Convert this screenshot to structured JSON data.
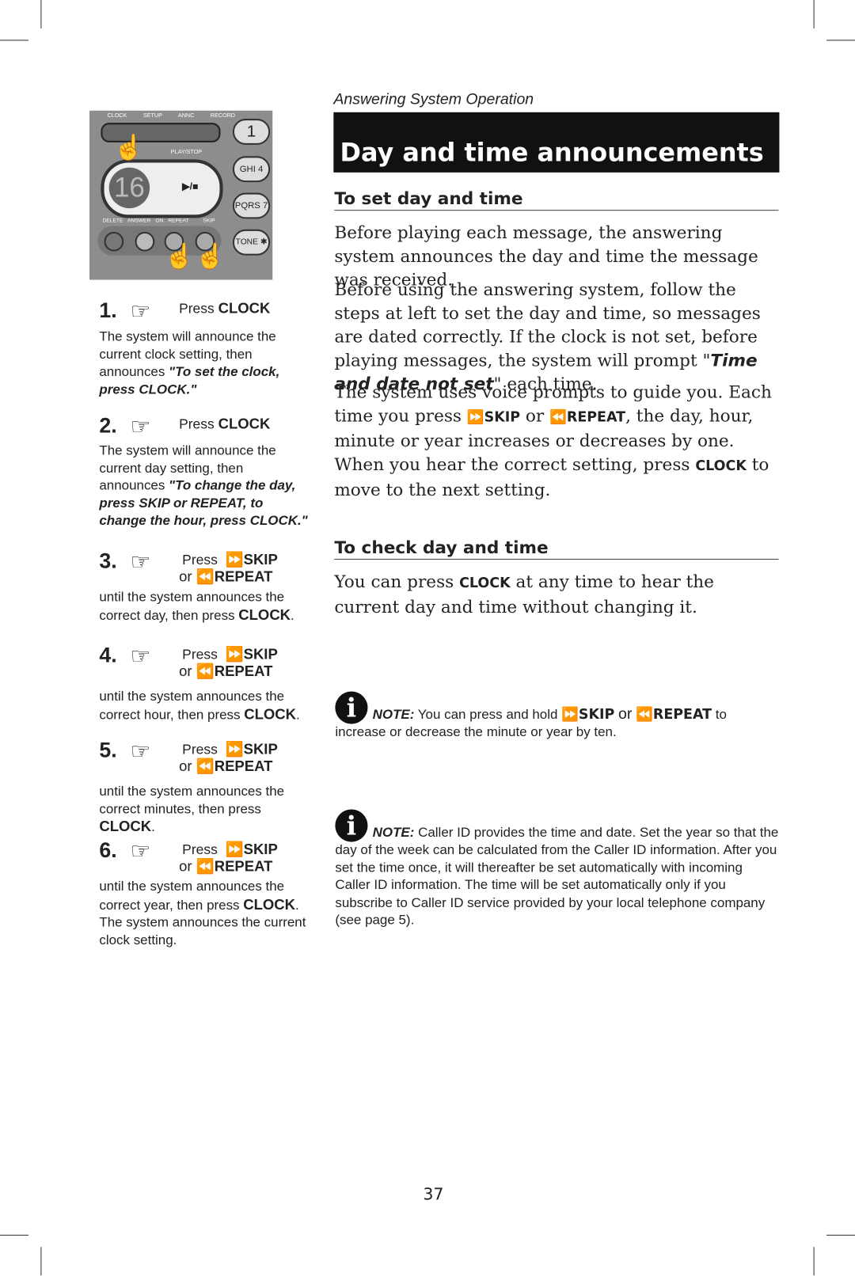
{
  "section": "Answering System Operation",
  "title": "Day and time announcements",
  "device": {
    "labels_top": [
      "CLOCK",
      "SETUP",
      "ANNC",
      "RECORD"
    ],
    "play_stop": "PLAY/STOP",
    "play_icon": "▶/■",
    "display": "16",
    "labels_bottom": [
      "DELETE",
      "ANSWER ON",
      "REPEAT",
      "SKIP"
    ],
    "keys": [
      "1",
      "GHI 4",
      "PQRS 7",
      "TONE ✱"
    ]
  },
  "steps": [
    {
      "num": "1.",
      "press": "Press",
      "key": "CLOCK",
      "desc": "The system will announce the current clock setting, then announces ",
      "quote": "\"To set the clock, press CLOCK.\""
    },
    {
      "num": "2.",
      "press": "Press",
      "key": "CLOCK",
      "desc": "The system will announce the current day setting, then announces ",
      "quote": "\"To change the day, press SKIP or REPEAT, to change the hour, press CLOCK.\""
    },
    {
      "num": "3.",
      "press": "Press",
      "skip": "SKIP",
      "or": "or",
      "repeat": "REPEAT",
      "desc": "until the system announces the correct day, then press ",
      "end": "CLOCK",
      "tail": "."
    },
    {
      "num": "4.",
      "press": "Press",
      "skip": "SKIP",
      "or": "or",
      "repeat": "REPEAT",
      "desc": "until the system announces the correct hour, then press ",
      "end": "CLOCK",
      "tail": "."
    },
    {
      "num": "5.",
      "press": "Press",
      "skip": "SKIP",
      "or": "or",
      "repeat": "REPEAT",
      "desc": "until the system announces the correct minutes, then press ",
      "end": "CLOCK",
      "tail": "."
    },
    {
      "num": "6.",
      "press": "Press",
      "skip": "SKIP",
      "or": "or",
      "repeat": "REPEAT",
      "desc": "until the system announces the correct year, then press ",
      "end": "CLOCK",
      "tail": ". The system announces the current clock setting."
    }
  ],
  "set": {
    "heading": "To set day and time",
    "p1": "Before playing each message, the answering system announces the day and time the message was received.",
    "p2a": "Before using the answering system, follow the steps at left to set the day and time, so messages are dated correctly. If the clock is not set, before playing messages, the system will prompt \"",
    "p2b": "Time and date not set",
    "p2c": "\" each time.",
    "p3a": "The system uses voice prompts to guide you. Each time you press ",
    "skip": "SKIP",
    "or": "or",
    "repeat": "REPEAT",
    "p3b": ", the day, hour, minute or year increases or decreases by one. When you hear the correct setting, press ",
    "clock": "CLOCK",
    "p3c": " to move to the next setting."
  },
  "check": {
    "heading": "To check day and time",
    "a": "You can press ",
    "clock": "CLOCK",
    "b": " at any time to hear the current day and time without changing it."
  },
  "note1": {
    "label": "NOTE:",
    "a": " You can press and hold ",
    "skip": "SKIP",
    "or": "or",
    "repeat": "REPEAT",
    "b": " to increase or decrease the minute or year by ten."
  },
  "note2": {
    "label": "NOTE:",
    "text": " Caller ID provides the time and date.  Set the year so that the day of the week can be calculated from the Caller ID information. After you set the time once, it will thereafter be set automatically with incoming Caller ID information. The time will be set automatically only if you subscribe to Caller ID service provided by your local telephone company (see page 5)."
  },
  "page_number": "37"
}
